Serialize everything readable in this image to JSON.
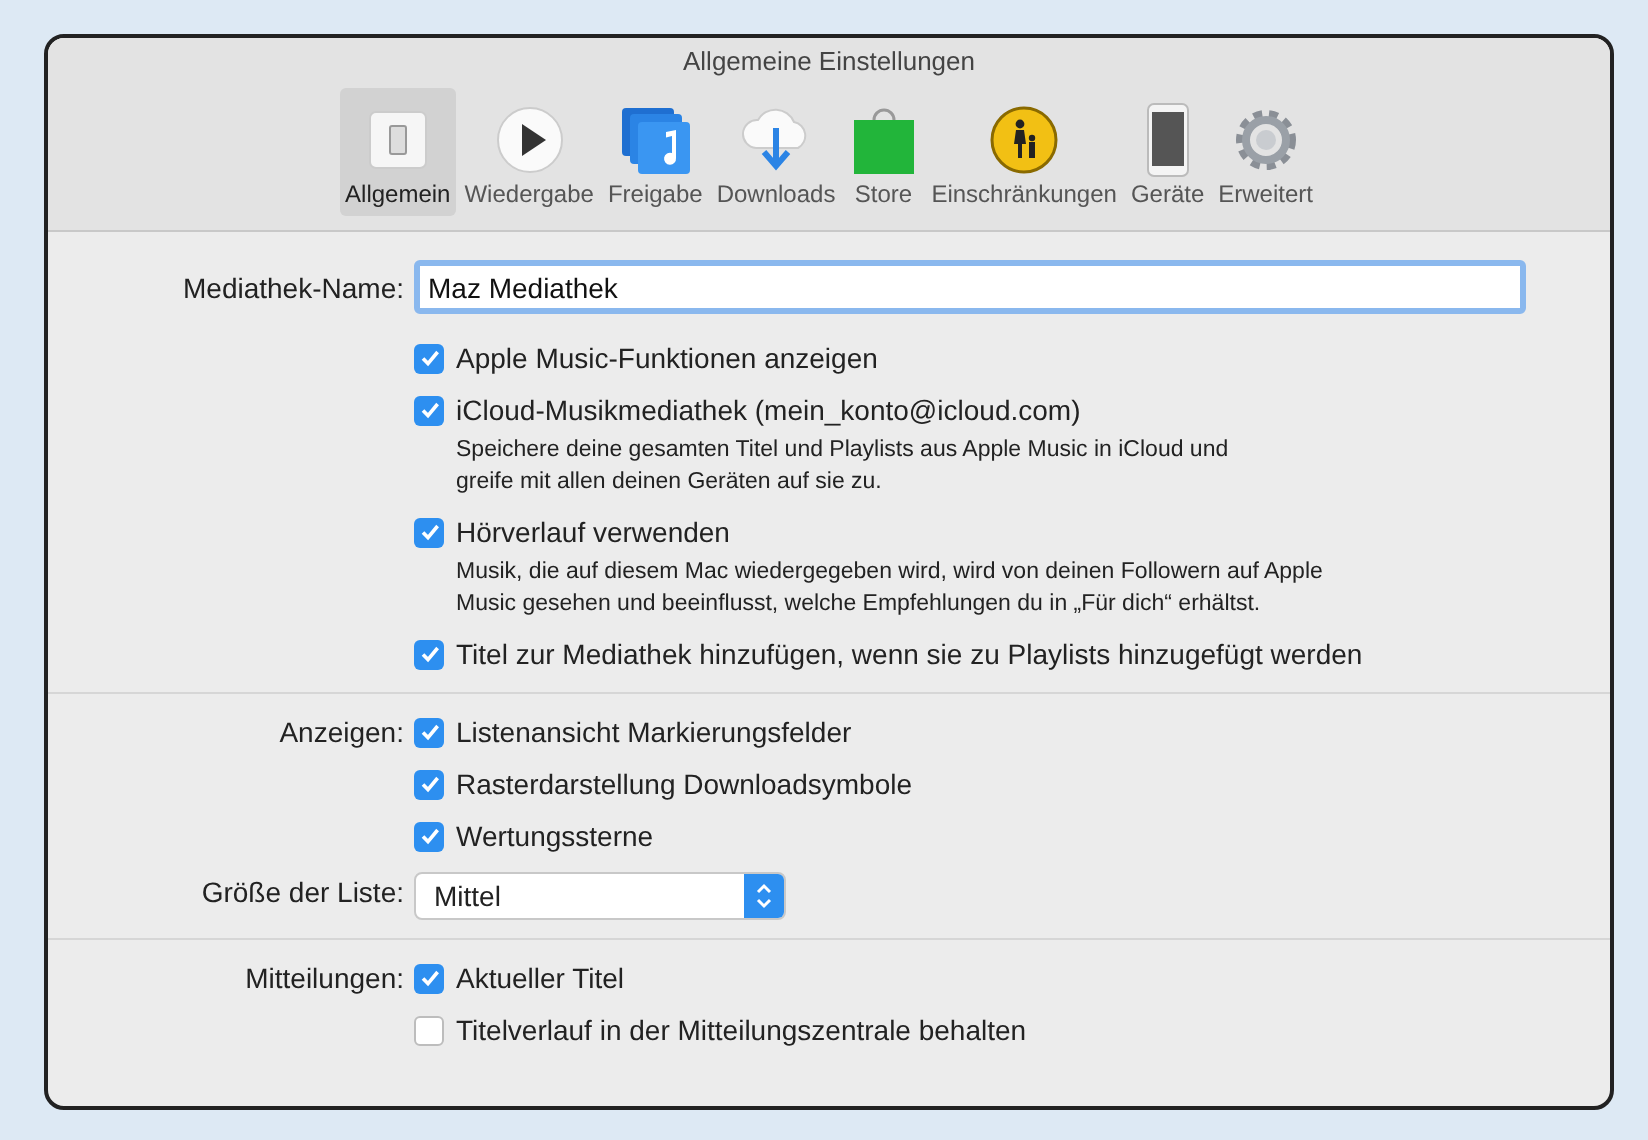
{
  "window": {
    "title": "Allgemeine Einstellungen"
  },
  "toolbar": [
    {
      "kind": "general",
      "label": "Allgemein",
      "selected": true
    },
    {
      "kind": "playback",
      "label": "Wiedergabe",
      "selected": false
    },
    {
      "kind": "sharing",
      "label": "Freigabe",
      "selected": false
    },
    {
      "kind": "downloads",
      "label": "Downloads",
      "selected": false
    },
    {
      "kind": "store",
      "label": "Store",
      "selected": false
    },
    {
      "kind": "restrictions",
      "label": "Einschränkungen",
      "selected": false
    },
    {
      "kind": "devices",
      "label": "Geräte",
      "selected": false
    },
    {
      "kind": "advanced",
      "label": "Erweitert",
      "selected": false
    }
  ],
  "sections": [
    {
      "rows": [
        {
          "kind": "text_field",
          "label": "Mediathek-Name:",
          "value": "Maz Mediathek"
        },
        {
          "kind": "checkbox",
          "text": "Apple Music-Funktionen anzeigen",
          "checked": true
        },
        {
          "kind": "checkbox",
          "text": "iCloud-Musikmediathek (mein_konto@icloud.com)",
          "checked": true,
          "description": [
            "Speichere deine gesamten Titel und Playlists aus Apple Music in iCloud und",
            "greife mit allen deinen Geräten auf sie zu."
          ]
        },
        {
          "kind": "checkbox",
          "text": "Hörverlauf verwenden",
          "checked": true,
          "description": [
            "Musik, die auf diesem Mac wiedergegeben wird, wird von deinen Followern auf Apple",
            "Music gesehen und beeinflusst, welche Empfehlungen du in „Für dich“ erhältst."
          ]
        },
        {
          "kind": "checkbox",
          "text": "Titel zur Mediathek hinzufügen, wenn sie zu Playlists hinzugefügt werden",
          "checked": true
        }
      ]
    },
    {
      "rows": [
        {
          "kind": "checkbox",
          "label": "Anzeigen:",
          "text": "Listenansicht Markierungsfelder",
          "checked": true
        },
        {
          "kind": "checkbox",
          "text": "Rasterdarstellung Downloadsymbole",
          "checked": true
        },
        {
          "kind": "checkbox",
          "text": "Wertungssterne",
          "checked": true
        },
        {
          "kind": "select",
          "label": "Größe der Liste:",
          "value": "Mittel"
        }
      ]
    },
    {
      "rows": [
        {
          "kind": "checkbox",
          "label": "Mitteilungen:",
          "text": "Aktueller Titel",
          "checked": true
        },
        {
          "kind": "checkbox",
          "text": "Titelverlauf in der Mitteilungszentrale behalten",
          "checked": false
        }
      ]
    }
  ]
}
